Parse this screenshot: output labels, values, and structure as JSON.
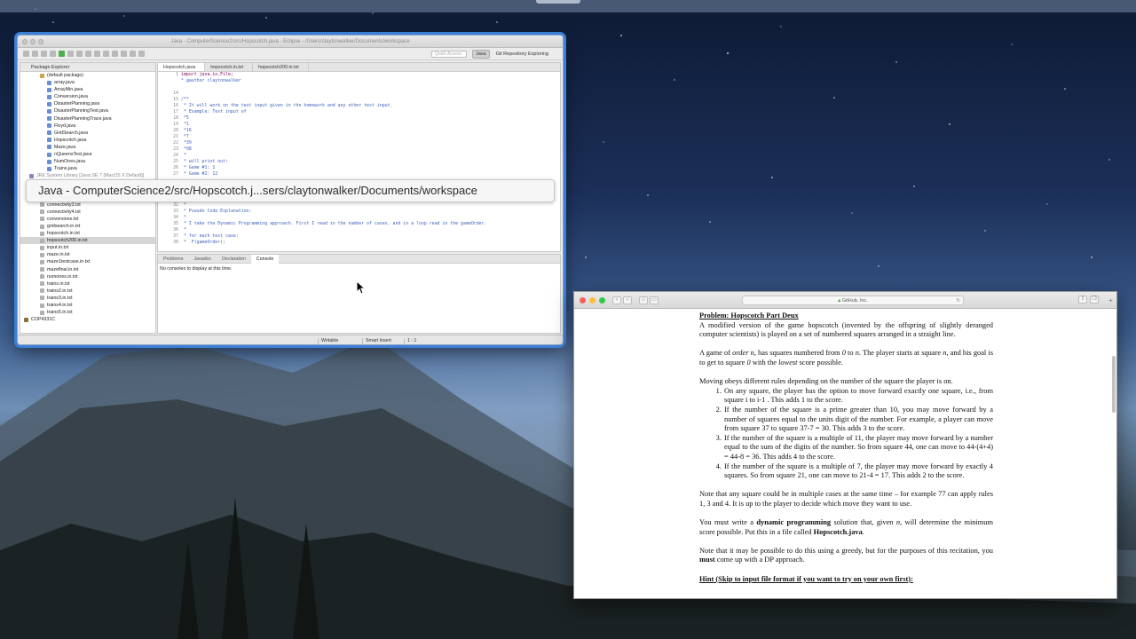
{
  "eclipse": {
    "window_title": "Java - ComputerScience2/src/Hopscotch.java - Eclipse - /Users/claytonwalker/Documents/workspace",
    "quick_access_placeholder": "Quick Access",
    "perspectives": [
      "Java",
      "Git Repository Exploring"
    ],
    "package_explorer_title": "Package Explorer",
    "package_items": [
      {
        "label": "(default package)",
        "kind": "pkg"
      },
      {
        "label": "array.java",
        "kind": "java"
      },
      {
        "label": "ArrayMin.java",
        "kind": "java"
      },
      {
        "label": "Conversion.java",
        "kind": "java"
      },
      {
        "label": "DisasterPlanning.java",
        "kind": "java"
      },
      {
        "label": "DisasterPlanningTest.java",
        "kind": "java"
      },
      {
        "label": "DisasterPlanningTrace.java",
        "kind": "java"
      },
      {
        "label": "Floyd.java",
        "kind": "java"
      },
      {
        "label": "GridSearch.java",
        "kind": "java"
      },
      {
        "label": "Hopscotch.java",
        "kind": "java"
      },
      {
        "label": "Maze.java",
        "kind": "java"
      },
      {
        "label": "nQueensTest.java",
        "kind": "java"
      },
      {
        "label": "NumOnes.java",
        "kind": "java"
      },
      {
        "label": "Trains.java",
        "kind": "java"
      },
      {
        "label": "JRE System Library [Java SE 7 (MacOS X Default)]",
        "kind": "lib"
      },
      {
        "label": "",
        "kind": "hidden"
      },
      {
        "label": "",
        "kind": "hidden"
      },
      {
        "label": "connectivity2.txt",
        "kind": "txt"
      },
      {
        "label": "connectivity3.txt",
        "kind": "txt"
      },
      {
        "label": "connectivity4.txt",
        "kind": "txt"
      },
      {
        "label": "conversions.txt",
        "kind": "txt"
      },
      {
        "label": "gridsearch.in.txt",
        "kind": "txt"
      },
      {
        "label": "hopscotch.in.txt",
        "kind": "txt"
      },
      {
        "label": "hopscotch200.in.txt",
        "kind": "txt",
        "selected": true
      },
      {
        "label": "input.in.txt",
        "kind": "txt"
      },
      {
        "label": "maze.in.txt",
        "kind": "txt"
      },
      {
        "label": "maze1testcase.in.txt",
        "kind": "txt"
      },
      {
        "label": "mazefinal.in.txt",
        "kind": "txt"
      },
      {
        "label": "numones.in.txt",
        "kind": "txt"
      },
      {
        "label": "trains.in.txt",
        "kind": "txt"
      },
      {
        "label": "trains2.in.txt",
        "kind": "txt"
      },
      {
        "label": "trains3.in.txt",
        "kind": "txt"
      },
      {
        "label": "trains4.in.txt",
        "kind": "txt"
      },
      {
        "label": "trains5.in.txt",
        "kind": "txt"
      },
      {
        "label": "COP4331C",
        "kind": "proj"
      }
    ],
    "editor_tabs": [
      "Hopscotch.java",
      "hopscotch.in.txt",
      "hopscotch200.in.txt"
    ],
    "code_lines": [
      {
        "n": "1",
        "t": "import java.io.File;",
        "kw": true
      },
      {
        "n": "",
        "t": "* @author claytonwalker",
        "kw": false
      },
      {
        "n": "",
        "t": "",
        "kw": false
      },
      {
        "n": "14",
        "t": "",
        "kw": false
      },
      {
        "n": "15",
        "t": "/**",
        "kw": false
      },
      {
        "n": "16",
        "t": " * It will work on the test input given in the homework and any other test input.",
        "kw": false
      },
      {
        "n": "17",
        "t": " * Example: Test input of",
        "kw": false
      },
      {
        "n": "18",
        "t": " *5",
        "kw": false
      },
      {
        "n": "19",
        "t": " *1",
        "kw": false
      },
      {
        "n": "20",
        "t": " *16",
        "kw": false
      },
      {
        "n": "21",
        "t": " *7",
        "kw": false
      },
      {
        "n": "22",
        "t": " *39",
        "kw": false
      },
      {
        "n": "23",
        "t": " *98",
        "kw": false
      },
      {
        "n": "24",
        "t": " *",
        "kw": false
      },
      {
        "n": "25",
        "t": " * will print out:",
        "kw": false
      },
      {
        "n": "26",
        "t": " * Game #1: 1",
        "kw": false
      },
      {
        "n": "27",
        "t": " * Game #2: 12",
        "kw": false
      },
      {
        "n": "",
        "t": "",
        "kw": false
      },
      {
        "n": "",
        "t": "",
        "kw": false
      },
      {
        "n": "",
        "t": "",
        "kw": false
      },
      {
        "n": "31",
        "t": " *",
        "kw": false
      },
      {
        "n": "32",
        "t": " *",
        "kw": false
      },
      {
        "n": "33",
        "t": " * Pseudo Code Explanation:",
        "kw": false
      },
      {
        "n": "34",
        "t": " *",
        "kw": false
      },
      {
        "n": "35",
        "t": " * I take the Dynamic Programming approach. First I read in the number of cases, and in a loop read in the gameOrder.",
        "kw": false
      },
      {
        "n": "36",
        "t": " *",
        "kw": false
      },
      {
        "n": "37",
        "t": " * for each test case:",
        "kw": false
      },
      {
        "n": "38",
        "t": " *  F(gameOrder);",
        "kw": false
      }
    ],
    "console_tabs": [
      "Problems",
      "Javadoc",
      "Declaration",
      "Console"
    ],
    "console_message": "No consoles to display at this time.",
    "status": {
      "writable": "Writable",
      "insert": "Smart Insert",
      "position": "1 : 1"
    }
  },
  "tooltip": "Java - ComputerScience2/src/Hopscotch.j...sers/claytonwalker/Documents/workspace",
  "safari": {
    "url_text": "GitHub, Inc.",
    "doc": {
      "heading": "Problem: Hopscotch Part Deux",
      "p1": "A modified version of the game hopscotch (invented by the offspring of slightly deranged computer scientists) is played on a set of numbered squares arranged in a straight line.",
      "p2_a": "A game of ",
      "p2_b": "order n",
      "p2_c": ", has squares numbered from ",
      "p2_d": "0",
      "p2_e": " to ",
      "p2_f": "n",
      "p2_g": ". The player starts at square ",
      "p2_h": "n",
      "p2_i": ", and his goal is to get to square ",
      "p2_j": "0",
      "p2_k": " with the ",
      "p2_l": "lowest",
      "p2_m": " score possible.",
      "p3": "Moving obeys different rules depending on the number of the square the player is on.",
      "rules": [
        "On any square, the player has the option to move forward exactly one square, i.e., from square i to i-1 . This adds 1 to the score.",
        "If the number of the square is a prime greater than 10, you may move forward by a number of squares equal to the units digit of the number. For example, a player can move from square 37 to square 37-7 = 30. This adds 3 to the score.",
        "If the number of the square is a multiple of 11, the player may move forward by a number equal to the sum of the digits of the number. So from square 44, one can move to 44-(4+4) = 44-8 = 36. This adds 4 to the score.",
        "If the number of the square is a multiple of 7, the player may move forward by exactly 4 squares. So from square 21, one can move to 21-4 = 17. This adds 2 to the score."
      ],
      "p4": "Note that any square could be in multiple cases at the same time – for example 77 can apply rules 1, 3 and 4. It is up to the player to decide which move they want to use.",
      "p5_a": "You must write a ",
      "p5_b": "dynamic programming",
      "p5_c": " solution that, given ",
      "p5_d": "n",
      "p5_e": ", will determine the minimum score possible. Put this in a file called ",
      "p5_f": "Hopscotch.java",
      "p5_g": ".",
      "p6_a": "Note that it may be possible to do this using a greedy, but for the purposes of this recitation, you ",
      "p6_b": "must",
      "p6_c": " come up with a DP approach.",
      "hint": "Hint (Skip to input file format if you want to try on your own first):"
    }
  }
}
